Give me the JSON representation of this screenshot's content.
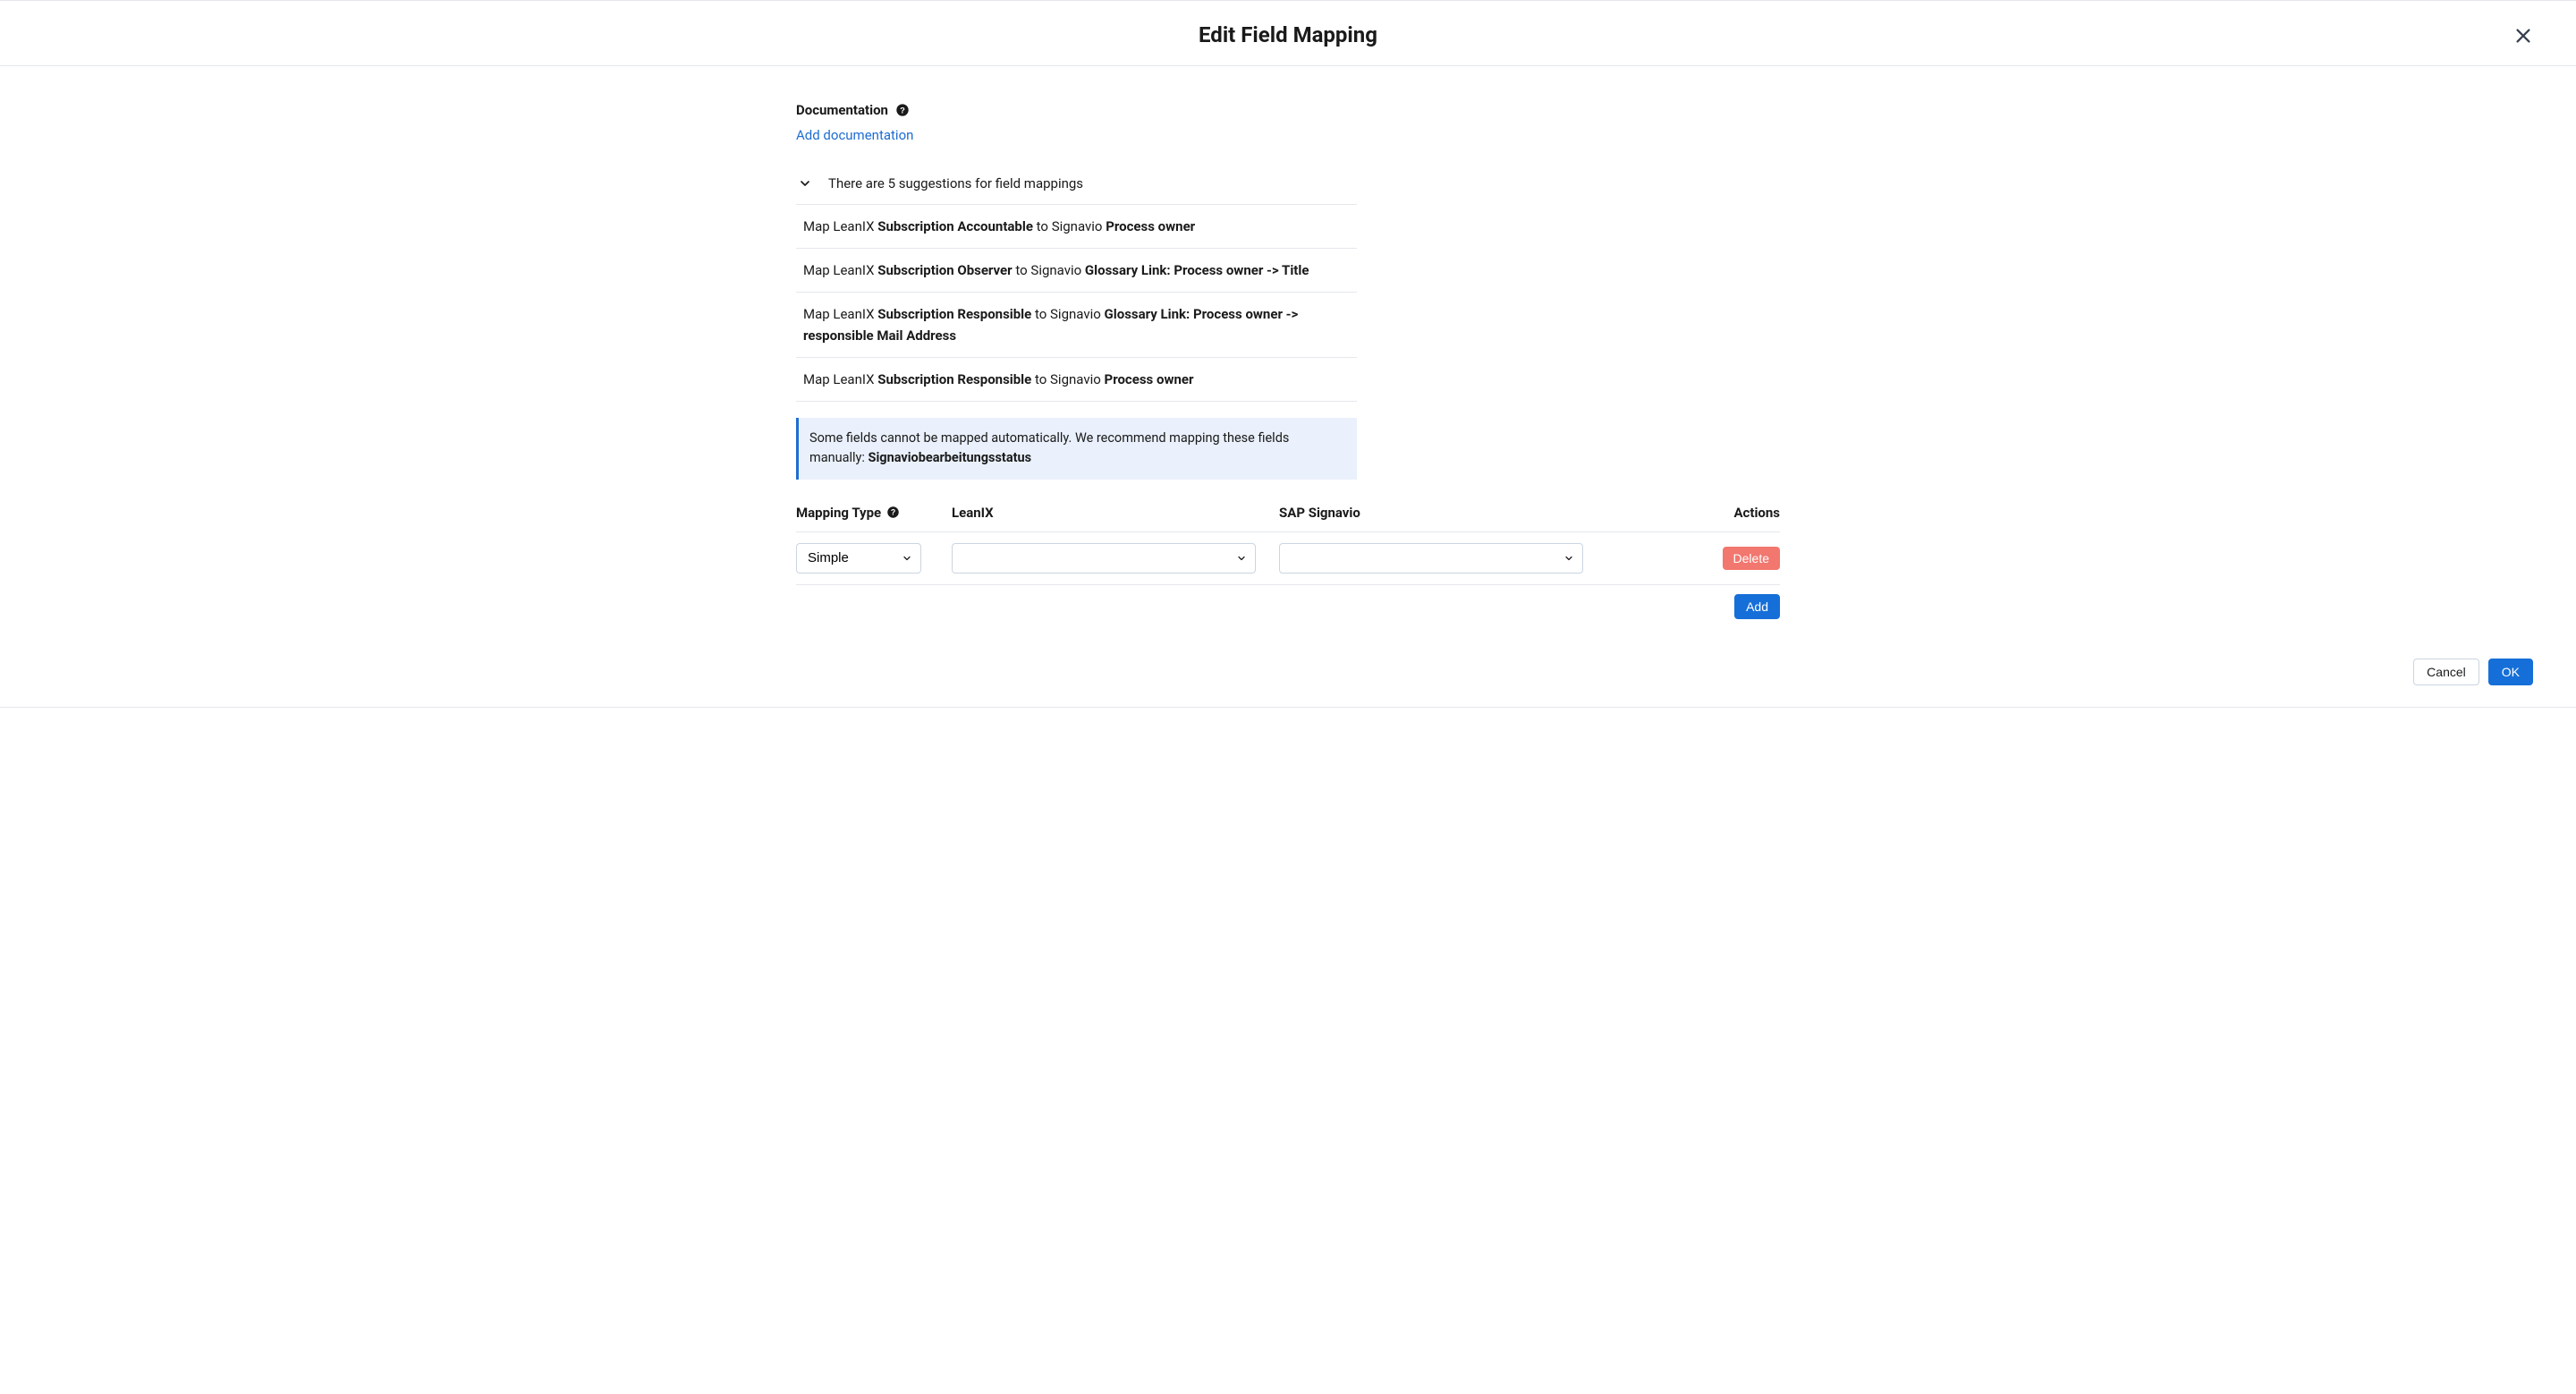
{
  "dialog": {
    "title": "Edit Field Mapping"
  },
  "documentation": {
    "label": "Documentation",
    "add_link": "Add documentation"
  },
  "suggestions": {
    "header": "There are 5 suggestions for field mappings",
    "items": [
      {
        "prefix": "Map LeanIX ",
        "source": "Subscription Accountable",
        "mid": " to Signavio ",
        "target": "Process owner"
      },
      {
        "prefix": "Map LeanIX ",
        "source": "Subscription Observer",
        "mid": " to Signavio ",
        "target": "Glossary Link: Process owner -> Title"
      },
      {
        "prefix": "Map LeanIX ",
        "source": "Subscription Responsible",
        "mid": " to Signavio ",
        "target": "Glossary Link: Process owner -> responsible Mail Address"
      },
      {
        "prefix": "Map LeanIX ",
        "source": "Subscription Responsible",
        "mid": " to Signavio ",
        "target": "Process owner"
      }
    ]
  },
  "notice": {
    "text": "Some fields cannot be mapped automatically. We recommend mapping these fields manually: ",
    "fields": "Signaviobearbeitungsstatus"
  },
  "table": {
    "header_type": "Mapping Type",
    "header_leanix": "LeanIX",
    "header_signavio": "SAP Signavio",
    "header_actions": "Actions",
    "row": {
      "type_value": "Simple",
      "leanix_value": "",
      "signavio_value": "",
      "delete_label": "Delete"
    },
    "add_label": "Add"
  },
  "footer": {
    "cancel": "Cancel",
    "ok": "OK"
  }
}
